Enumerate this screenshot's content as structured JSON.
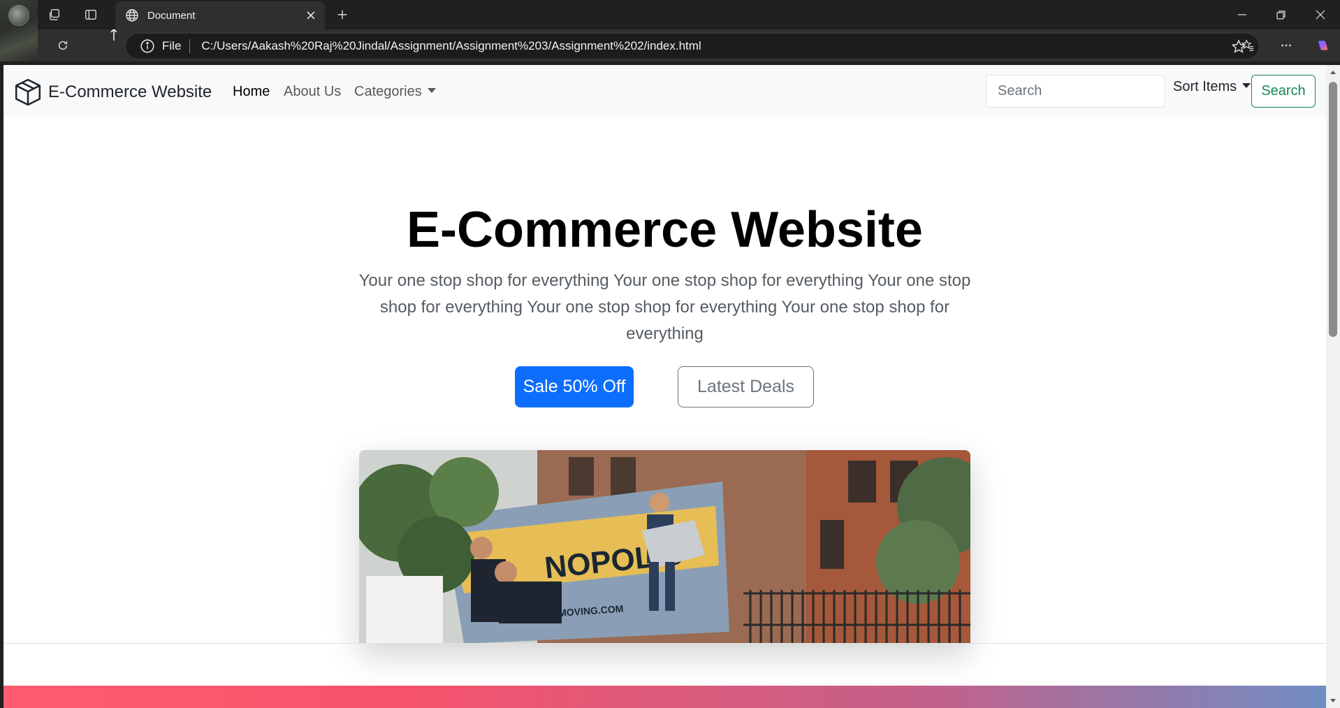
{
  "browser": {
    "tab_title": "Document",
    "address_scheme": "File",
    "address_url": "C:/Users/Aakash%20Raj%20Jindal/Assignment/Assignment%203/Assignment%202/index.html"
  },
  "navbar": {
    "brand": "E-Commerce Website",
    "links": [
      "Home",
      "About Us",
      "Categories"
    ],
    "search_placeholder": "Search",
    "sort_label": "Sort Items",
    "search_button": "Search"
  },
  "hero": {
    "title": "E-Commerce Website",
    "lead": "Your one stop shop for everything Your one stop shop for everything Your one stop shop for everything Your one stop shop for everything Your one stop shop for everything",
    "primary_button": "Sale 50% Off",
    "secondary_button": "Latest Deals",
    "image_alt": "Movers loading a truck on a city street",
    "truck_text": "NOPOLIS",
    "truck_web": "MOVING.COM"
  },
  "colors": {
    "primary": "#0d6efd",
    "success": "#198754",
    "secondary": "#6c757d",
    "navbar_bg": "#f8f9fa"
  }
}
